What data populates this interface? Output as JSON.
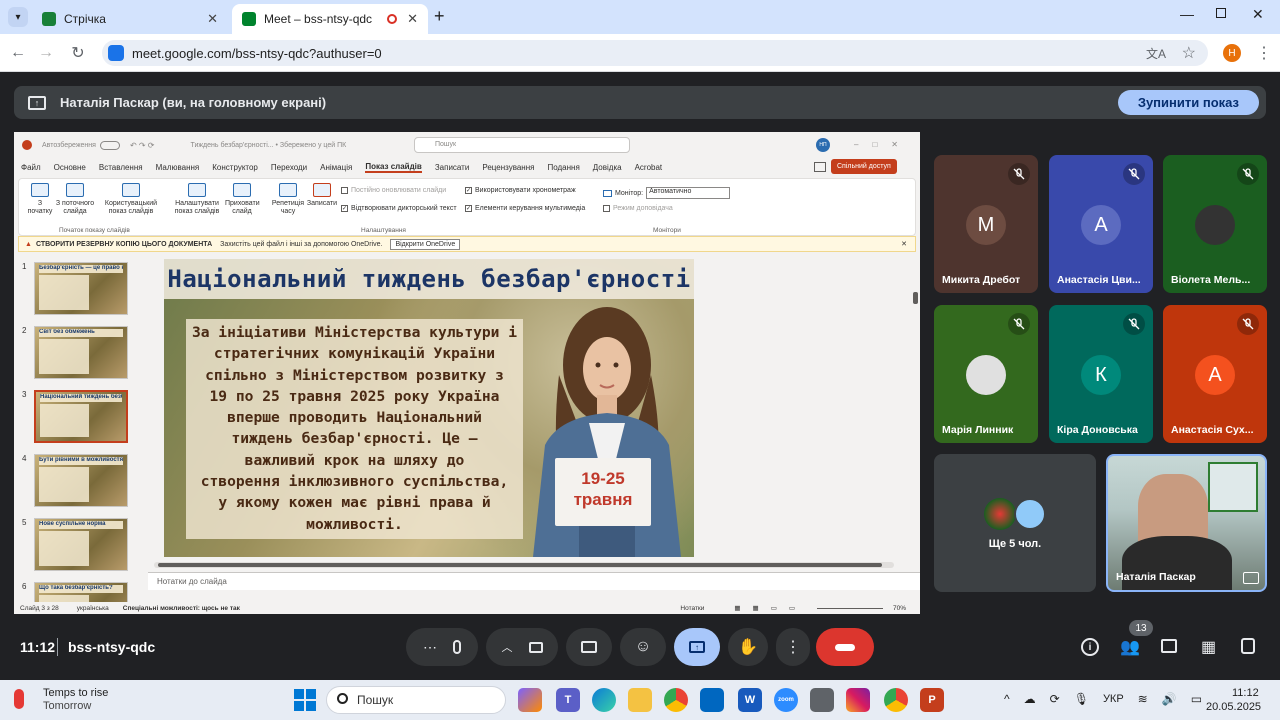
{
  "browser": {
    "tabs": [
      {
        "title": "Стрічка",
        "favicon_color": "#188038"
      },
      {
        "title": "Meet – bss-ntsy-qdc",
        "favicon_color": "#00832d"
      }
    ],
    "url": "meet.google.com/bss-ntsy-qdc?authuser=0",
    "profile_initial": "Н"
  },
  "meet": {
    "share_banner": "Наталія Паскар (ви, на головному екрані)",
    "stop_button": "Зупинити показ",
    "time": "11:12",
    "meeting_code": "bss-ntsy-qdc",
    "participant_count": "13",
    "more_people": "Ще 5 чол.",
    "participants": [
      {
        "name": "Микита Дребот",
        "initial": "М",
        "bg": "#4e342e",
        "avatar": "#6d4c41",
        "muted": true
      },
      {
        "name": "Анастасія Цви...",
        "initial": "А",
        "bg": "#3949ab",
        "avatar": "#5c6bc0",
        "muted": true
      },
      {
        "name": "Віолета Мель...",
        "initial": "",
        "bg": "#1b5e20",
        "avatar": "#333",
        "muted": true
      },
      {
        "name": "Марія Линник",
        "initial": "",
        "bg": "#33691e",
        "avatar": "#e0e0e0",
        "muted": true
      },
      {
        "name": "Кіра Доновська",
        "initial": "К",
        "bg": "#00695c",
        "avatar": "#00897b",
        "muted": true
      },
      {
        "name": "Анастасія Сух...",
        "initial": "А",
        "bg": "#bf360c",
        "avatar": "#f4511e",
        "muted": true
      }
    ],
    "self_name": "Наталія Паскар"
  },
  "powerpoint": {
    "autosave": "Автозбереження",
    "doc_title": "Тиждень безбар'єрності... • Збережено у цей ПК",
    "search_placeholder": "Пошук",
    "user_initials": "НП",
    "menu": [
      "Файл",
      "Основне",
      "Вставлення",
      "Малювання",
      "Конструктор",
      "Переходи",
      "Анімація",
      "Показ слайдів",
      "Записати",
      "Рецензування",
      "Подання",
      "Довідка",
      "Acrobat"
    ],
    "share_button": "Спільний доступ",
    "ribbon": {
      "from_start": "З початку",
      "from_current": "З поточного слайда",
      "custom_show": "Користувацький показ слайдів",
      "setup_show": "Налаштувати показ слайдів",
      "hide_slide": "Приховати слайд",
      "rehearse": "Репетиція часу",
      "record": "Записати",
      "keep_updated": "Постійно оновлювати слайди",
      "play_narrations": "Відтворювати дикторський текст",
      "use_timings": "Використовувати хронометраж",
      "media_controls": "Елементи керування мультимедіа",
      "monitor_label": "Монітор:",
      "monitor_value": "Автоматично",
      "presenter_view": "Режим доповідача",
      "group_start": "Початок показу слайдів",
      "group_setup": "Налаштування",
      "group_monitors": "Монітори"
    },
    "notification": {
      "title": "СТВОРИТИ РЕЗЕРВНУ КОПІЮ ЦЬОГО ДОКУМЕНТА",
      "text": "Захистіть цей файл і інші за допомогою OneDrive.",
      "button": "Відкрити OneDrive"
    },
    "thumbnails": [
      {
        "num": "1",
        "title": "Безбар'єрність — це право кожного"
      },
      {
        "num": "2",
        "title": "Світ без обмежень"
      },
      {
        "num": "3",
        "title": "Національний тиждень безбар'єрності"
      },
      {
        "num": "4",
        "title": "Бути рівними в можливостях"
      },
      {
        "num": "5",
        "title": "Нове суспільне норма"
      },
      {
        "num": "6",
        "title": "Що така безбар'єрність?"
      }
    ],
    "slide": {
      "title": "Національний тиждень безбар'єрності",
      "body_lines": [
        "За ініціативи Міністерства культури і",
        "стратегічних комунікацій України",
        "спільно з Міністерством розвитку з",
        "19 по 25 травня 2025 року Україна",
        "вперше проводить Національний",
        "тиждень безбар'єрності. Це –",
        "важливий крок на шляху до",
        "створення інклюзивного суспільства,",
        "у якому кожен має рівні права й",
        "можливості."
      ],
      "sign_line1": "19-25",
      "sign_line2": "травня"
    },
    "notes_placeholder": "Нотатки до слайда",
    "status": {
      "slide": "Слайд 3 з 28",
      "language": "українська",
      "accessibility": "Спеціальні можливості: щось не так",
      "notes": "Нотатки",
      "zoom": "70%"
    }
  },
  "taskbar": {
    "weather_title": "Temps to rise",
    "weather_sub": "Tomorrow",
    "search": "Пошук",
    "language": "УКР",
    "time": "11:12",
    "date": "20.05.2025"
  }
}
